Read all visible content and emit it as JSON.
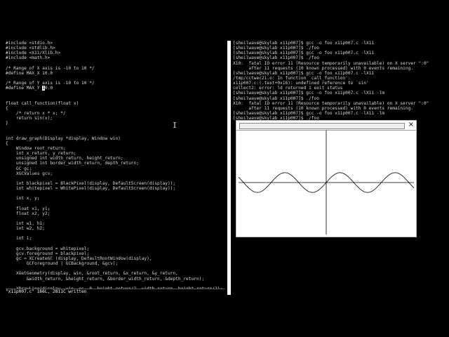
{
  "editor": {
    "lines": [
      "#include <stdio.h>",
      "#include <stdlib.h>",
      "#include <X11/Xlib.h>",
      "#include <math.h>",
      "",
      "/* Range of X axis is -10 to 10 */",
      "#define MAX_X 10.0",
      "",
      "/* Range of Y axis is -10 to 10 */",
      "#define MAX_Y ",
      "",
      "",
      "float call_function(float x)",
      "{",
      "    /* return x * x; */",
      "    return sin(x);",
      "}",
      "",
      "",
      "int draw_graph(Display *display, Window win)",
      "{",
      "    Window root_return;",
      "    int x_return, y_return;",
      "    unsigned int width_return, height_return;",
      "    unsigned int border_width_return, depth_return;",
      "    GC gc;",
      "    XGCValues gcv;",
      "",
      "    int blackpixel = BlackPixel(display, DefaultScreen(display));",
      "    int whitepixel = WhitePixel(display, DefaultScreen(display));",
      "",
      "    int x, y;",
      "",
      "    float x1, y1;",
      "    float x2, y2;",
      "",
      "    int w1, h1;",
      "    int w2, h2;",
      "",
      "    int i;",
      "",
      "    gcv.background = whitepixel;",
      "    gcv.foreground = blackpixel;",
      "    gc = XCreateGC (display, DefaultRootWindow(display),",
      "        GCForeground | GCBackground, &gcv);",
      "",
      "    XGetGeometry(display, win, &root_return, &x_return, &y_return,",
      "        &width_return, &height_return, &border_width_return, &depth_return);",
      "",
      "    XDrawLine(display, win, gc, 0, height_return/2, width_return, height_return/2);"
    ],
    "cursor_char": "1",
    "cursor_after": "0.0",
    "status": "\"x11p007.c\" 166L, 2811C written"
  },
  "shell": {
    "lines": [
      "[sheilwave@skylab x11p007]$ gcc -o foo x11p007.c -lX11",
      "[sheilwave@skylab x11p007]$ ./foo",
      "[sheilwave@skylab x11p007]$ gcc -o foo x11p007.c -lX11",
      "[sheilwave@skylab x11p007]$ ./foo",
      "X10:  fatal IO error 11 (Resource temporarily unavailable) on X server \":0\"",
      "      after 11 requests (10 known processed) with 0 events remaining.",
      "[sheilwave@skylab x11p007]$ gcc -o foo x11p007.c -lX11",
      "/tmp/cctwec2i.o: In function `call_function':",
      "x11p007.c:(.text+0x16): undefined reference to `sin'",
      "collect2: error: ld returned 1 exit status",
      "[sheilwave@skylab x11p007]$ gcc -o foo x11p007.c -lX11 -lm",
      "[sheilwave@skylab x11p007]$ ./foo",
      "X10:  fatal IO error 11 (Resource temporarily unavailable) on X server \":0\"",
      "      after 11 requests (10 known processed) with 0 events remaining.",
      "[sheilwave@skylab x11p007]$ gcc -o foo x11p007.c -lX11 -lm",
      "[sheilwave@skylab x11p007]$ ./foo"
    ]
  },
  "xwindow": {
    "close_glyph": "×",
    "plot": {
      "function": "sin",
      "x_range": [
        -10,
        10
      ],
      "y_range": [
        -10,
        10
      ]
    }
  },
  "colors": {
    "terminal_bg": "#000000",
    "terminal_fg": "#d8d8d8",
    "window_bg": "#ffffff",
    "plot_stroke": "#000000"
  }
}
